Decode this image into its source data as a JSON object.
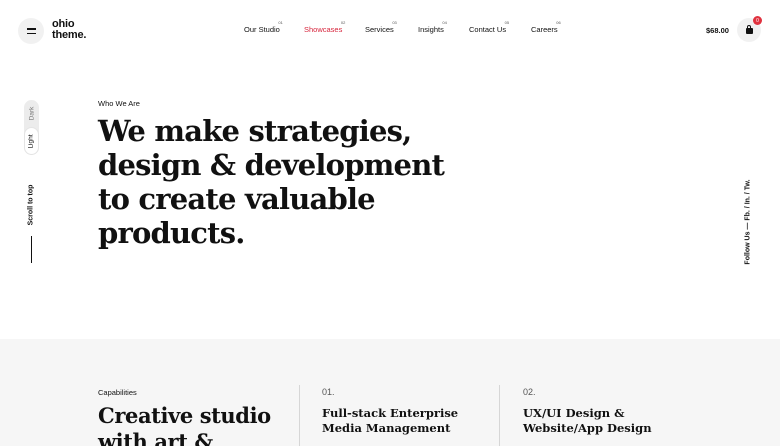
{
  "header": {
    "logo_line1": "ohio",
    "logo_line2": "theme.",
    "nav": [
      {
        "label": "Our Studio",
        "index": "01"
      },
      {
        "label": "Showcases",
        "index": "02",
        "active": true
      },
      {
        "label": "Services",
        "index": "03"
      },
      {
        "label": "Insights",
        "index": "04"
      },
      {
        "label": "Contact Us",
        "index": "05"
      },
      {
        "label": "Careers",
        "index": "06"
      }
    ],
    "cart_total": "$68.00",
    "cart_count": "0"
  },
  "mode_switch": {
    "dark_label": "Dark",
    "light_label": "Light",
    "selected": "Light"
  },
  "scroll_to_top_label": "Scroll to top",
  "follow_us": "Follow Us  —  Fb.  /  In.  /  Tw.",
  "hero": {
    "eyebrow": "Who We Are",
    "headline_lines": [
      "We make strategies,",
      "design & development",
      "to create valuable",
      "products."
    ]
  },
  "capabilities": {
    "label": "Capabilities",
    "title_lines": [
      "Creative studio",
      "with art &"
    ],
    "services": [
      {
        "number": "01.",
        "lines": [
          "Full-stack Enterprise",
          "Media Management"
        ]
      },
      {
        "number": "02.",
        "lines": [
          "UX/UI Design &",
          "Website/App Design"
        ]
      }
    ]
  },
  "colors": {
    "accent": "#d7263d",
    "badge": "#e0323f",
    "section_bg": "#f6f6f6"
  },
  "icons": {
    "menu": "hamburger-icon",
    "cart": "shopping-bag-icon"
  }
}
